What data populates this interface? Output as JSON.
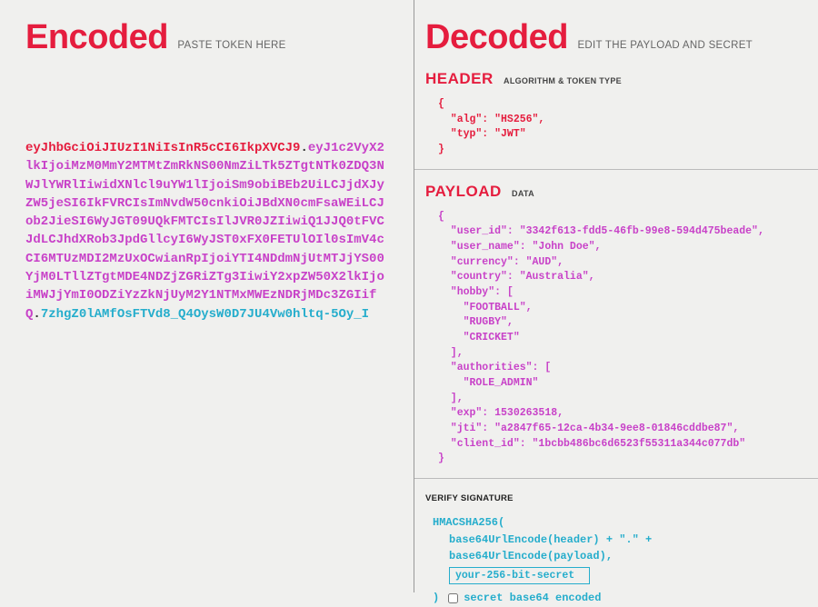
{
  "left": {
    "title": "Encoded",
    "hint": "PASTE TOKEN HERE",
    "jwt_header": "eyJhbGciOiJIUzI1NiIsInR5cCI6IkpXVCJ9",
    "jwt_payload": "eyJ1c2VyX2lkIjoiMzM0MmY2MTMtZmRkNS00NmZiLTk5ZTgtNTk0ZDQ3NWJlYWRlIiwidXNlcl9uYW1lIjoiSm9obiBEb2UiLCJjdXJyZW5jeSI6IkFVRCIsImNvdW50cnkiOiJBdXN0cmFsaWEiLCJob2JieSI6WyJGT09UQkFMTCIsIlJVR0JZIiwiQ1JJQ0tFVCJdLCJhdXRob3JpdGllcyI6WyJST0xFX0FETUlOIl0sImV4cCI6MTUzMDI2MzUxOCwianRpIjoiYTI4NDdmNjUtMTJjYS00YjM0LTllZTgtMDE4NDZjZGRiZTg3IiwiY2xpZW50X2lkIjoiMWJjYmI0ODZiYzZkNjUyM2Y1NTMxMWEzNDRjMDc3ZGIifQ",
    "jwt_signature": "7zhgZ0lAMfOsFTVd8_Q4OysW0D7JU4Vw0hltq-5Oy_I"
  },
  "right": {
    "title": "Decoded",
    "hint": "EDIT THE PAYLOAD AND SECRET",
    "header_section": {
      "title": "HEADER",
      "sub": "ALGORITHM & TOKEN TYPE",
      "json_lines": [
        "{",
        "  \"alg\": \"HS256\",",
        "  \"typ\": \"JWT\"",
        "}"
      ]
    },
    "payload_section": {
      "title": "PAYLOAD",
      "sub": "DATA",
      "json_obj": {
        "user_id": "3342f613-fdd5-46fb-99e8-594d475beade",
        "user_name": "John Doe",
        "currency": "AUD",
        "country": "Australia",
        "hobby": [
          "FOOTBALL",
          "RUGBY",
          "CRICKET"
        ],
        "authorities": [
          "ROLE_ADMIN"
        ],
        "exp": 1530263518,
        "jti": "a2847f65-12ca-4b34-9ee8-01846cddbe87",
        "client_id": "1bcbb486bc6d6523f55311a344c077db"
      },
      "json_lines": [
        "{",
        "  \"user_id\": \"3342f613-fdd5-46fb-99e8-594d475beade\",",
        "  \"user_name\": \"John Doe\",",
        "  \"currency\": \"AUD\",",
        "  \"country\": \"Australia\",",
        "  \"hobby\": [",
        "    \"FOOTBALL\",",
        "    \"RUGBY\",",
        "    \"CRICKET\"",
        "  ],",
        "  \"authorities\": [",
        "    \"ROLE_ADMIN\"",
        "  ],",
        "  \"exp\": 1530263518,",
        "  \"jti\": \"a2847f65-12ca-4b34-9ee8-01846cddbe87\",",
        "  \"client_id\": \"1bcbb486bc6d6523f55311a344c077db\"",
        "}"
      ]
    },
    "signature_section": {
      "title": "VERIFY SIGNATURE",
      "fn_open": "HMACSHA256(",
      "line1": "base64UrlEncode(header) + \".\" +",
      "line2": "base64UrlEncode(payload),",
      "secret_placeholder": "your-256-bit-secret",
      "fn_close": ")",
      "checkbox_label": "secret base64 encoded"
    }
  }
}
